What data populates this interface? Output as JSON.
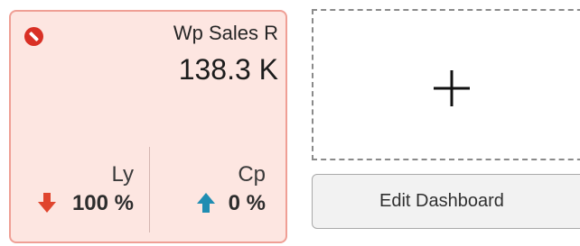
{
  "kpi_tile": {
    "title": "Wp Sales R",
    "value": "138.3 K",
    "status_icon": "no-entry-icon",
    "status_color": "#d93025",
    "card_bg": "#fde6e1",
    "card_border": "#ef9f95",
    "comparisons": [
      {
        "label": "Ly",
        "value": "100 %",
        "direction": "down",
        "icon": "arrow-down-icon",
        "color": "#e0452e"
      },
      {
        "label": "Cp",
        "value": "0 %",
        "direction": "up",
        "icon": "arrow-up-icon",
        "color": "#1f8db2"
      }
    ]
  },
  "add_tile": {
    "icon": "plus-icon"
  },
  "edit_button": {
    "label": "Edit Dashboard"
  }
}
